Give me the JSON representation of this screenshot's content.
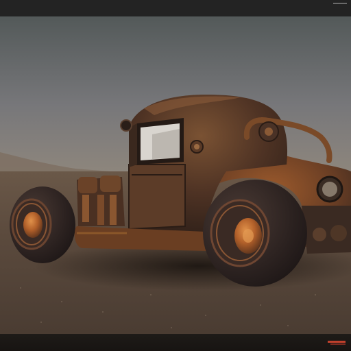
{
  "image": {
    "subject": "rusty-steampunk-hot-rod",
    "colors": {
      "sky_top": "#545a5a",
      "sky_bottom": "#8a8780",
      "ground": "#5a4a3e",
      "rust": "#8a4e26",
      "metal_dark": "#3b2a20",
      "tire": "#2e2422",
      "rim_orange": "#c06a2a"
    }
  }
}
